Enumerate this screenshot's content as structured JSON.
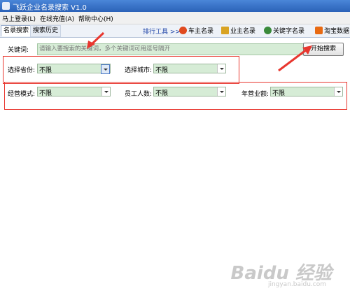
{
  "window": {
    "title": "飞跃企业名录搜索 V1.0"
  },
  "menu": {
    "items": [
      "马上登录(L)",
      "在线充值(A)",
      "帮助中心(H)"
    ]
  },
  "tabs": {
    "search": "名录搜索",
    "history": "搜索历史"
  },
  "toolbar": {
    "ranking_label": "排行工具 >>",
    "buttons": [
      {
        "label": "车主名录",
        "icon": "car-icon",
        "color": "#e04a1f"
      },
      {
        "label": "业主名录",
        "icon": "house-icon",
        "color": "#d9a323"
      },
      {
        "label": "关键字名录",
        "icon": "search-globe-icon",
        "color": "#3a8a3a"
      },
      {
        "label": "淘宝数据",
        "icon": "taobao-icon",
        "color": "#e86a12"
      }
    ]
  },
  "search": {
    "keyword_label": "关键词:",
    "keyword_placeholder": "请输入要搜索的关键词，多个关键词可用逗号隔开",
    "button_label": "开始搜索"
  },
  "filters": {
    "province_label": "选择省份:",
    "province_value": "不限",
    "city_label": "选择城市:",
    "city_value": "不限",
    "mode_label": "经营模式:",
    "mode_value": "不限",
    "staff_label": "员工人数:",
    "staff_value": "不限",
    "revenue_label": "年营业额:",
    "revenue_value": "不限"
  },
  "watermark": {
    "main": "Baidu 经验",
    "sub": "jingyan.baidu.com"
  },
  "colors": {
    "highlight": "#e8372f",
    "input_bg": "#d6ecd6",
    "titlebar": "#2b62b8"
  }
}
